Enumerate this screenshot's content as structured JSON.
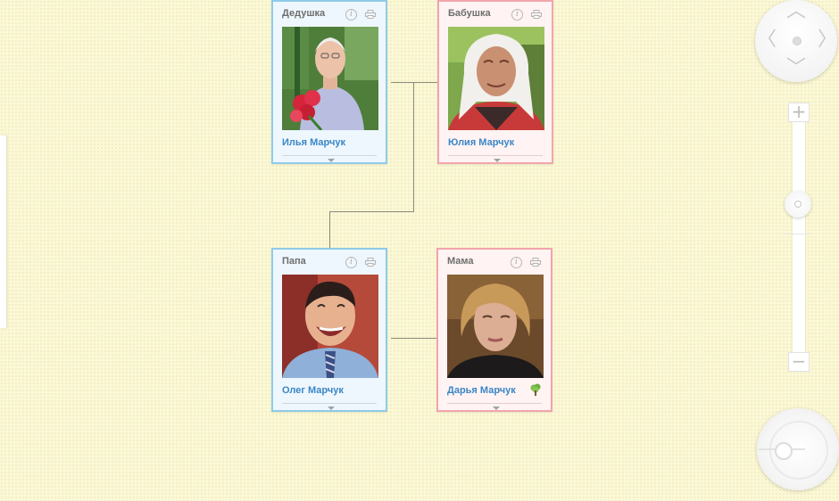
{
  "family_tree": {
    "grandfather": {
      "role": "Дедушка",
      "name": "Илья Марчук"
    },
    "grandmother": {
      "role": "Бабушка",
      "name": "Юлия Марчук"
    },
    "father": {
      "role": "Папа",
      "name": "Олег Марчук"
    },
    "mother": {
      "role": "Мама",
      "name": "Дарья Марчук"
    }
  },
  "icons": {
    "info": "info-icon",
    "print": "print-icon",
    "expand": "chevron-down-icon",
    "tree": "tree-icon"
  },
  "controls": {
    "zoom_in_label": "+",
    "zoom_out_label": "−",
    "pan_up": "︿",
    "pan_down": "﹀",
    "pan_left": "〈",
    "pan_right": "〉",
    "zoom_level": 0.65
  },
  "colors": {
    "male_border": "#8fcbe8",
    "female_border": "#f1a5ab",
    "name_link": "#3b86c6",
    "background": "#fbf8d6"
  }
}
